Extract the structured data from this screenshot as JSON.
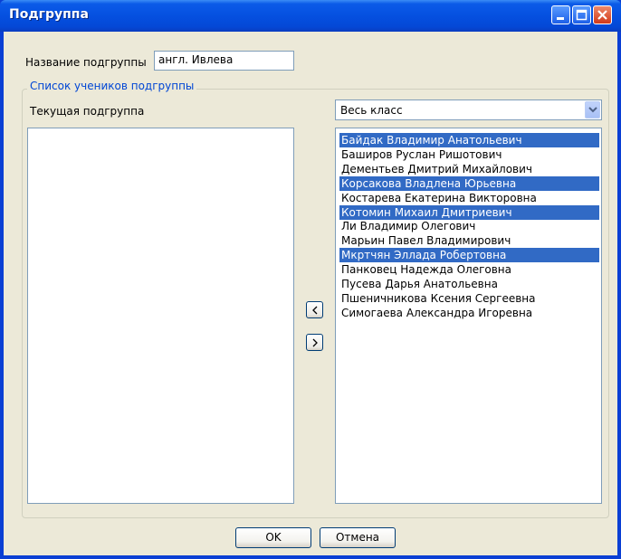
{
  "window": {
    "title": "Подгруппа"
  },
  "form": {
    "name_label": "Название подгруппы",
    "name_value": "англ. Ивлева",
    "group_title": "Список учеников подгруппы",
    "current_label": "Текущая подгруппа",
    "class_select_value": "Весь класс"
  },
  "left_list": {
    "items": []
  },
  "right_list": {
    "items": [
      {
        "text": "Байдак  Владимир   Анатольевич",
        "selected": true
      },
      {
        "text": "Баширов Руслан  Ришотович",
        "selected": false
      },
      {
        "text": "Дементьев  Дмитрий Михайлович",
        "selected": false
      },
      {
        "text": "Корсакова Владлена Юрьевна",
        "selected": true
      },
      {
        "text": "Костарева Екатерина Викторовна",
        "selected": false
      },
      {
        "text": "Котомин Михаил  Дмитриевич",
        "selected": true
      },
      {
        "text": "Ли Владимир  Олегович",
        "selected": false
      },
      {
        "text": "Марьин Павел Владимирович",
        "selected": false
      },
      {
        "text": "Мкртчян Эллада Робертовна",
        "selected": true
      },
      {
        "text": "Панковец Надежда Олеговна",
        "selected": false
      },
      {
        "text": "Пусева Дарья Анатольевна",
        "selected": false
      },
      {
        "text": "Пшеничникова Ксения Сергеевна",
        "selected": false
      },
      {
        "text": "Симогаева Александра Игоревна",
        "selected": false
      }
    ]
  },
  "transfer": {
    "move_left": "<",
    "move_right": ">"
  },
  "buttons": {
    "ok": "OK",
    "cancel": "Отмена"
  },
  "colors": {
    "selection": "#316ac5",
    "dialog_bg": "#ece9d8",
    "group_title": "#0046d5"
  }
}
